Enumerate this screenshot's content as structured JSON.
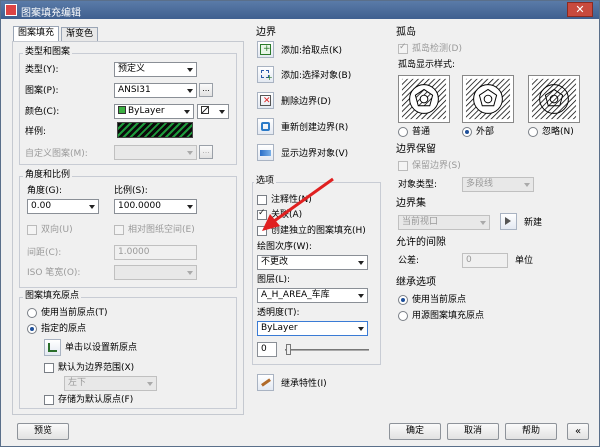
{
  "window": {
    "title": "图案填充编辑",
    "close_glyph": "✕"
  },
  "tabs": [
    {
      "label": "图案填充"
    },
    {
      "label": "渐变色"
    }
  ],
  "type_pattern": {
    "group_title": "类型和图案",
    "type_label": "类型(Y):",
    "type_value": "预定义",
    "pattern_label": "图案(P):",
    "pattern_value": "ANSI31",
    "color_label": "颜色(C):",
    "color_value": "ByLayer",
    "color_swatch": "#3cb043",
    "sample_label": "样例:",
    "custom_label": "自定义图案(M):",
    "browse_glyph": "..."
  },
  "angle_scale": {
    "group_title": "角度和比例",
    "angle_label": "角度(G):",
    "angle_value": "0.00",
    "scale_label": "比例(S):",
    "scale_value": "100.0000",
    "double_label": "双向(U)",
    "relative_label": "相对图纸空间(E)",
    "spacing_label": "间距(C):",
    "spacing_value": "1.0000",
    "iso_label": "ISO 笔宽(O):"
  },
  "origin": {
    "group_title": "图案填充原点",
    "current_label": "使用当前原点(T)",
    "specified_label": "指定的原点",
    "click_set_label": "单击以设置新原点",
    "default_extent_label": "默认为边界范围(X)",
    "extent_value": "左下",
    "store_label": "存储为默认原点(F)"
  },
  "boundary": {
    "group_title": "边界",
    "pick_points": "添加:拾取点(K)",
    "select_objects": "添加:选择对象(B)",
    "remove": "删除边界(D)",
    "recreate": "重新创建边界(R)",
    "display": "显示边界对象(V)"
  },
  "options": {
    "group_title": "选项",
    "annotative": "注释性(N)",
    "associative": "关联(A)",
    "separate": "创建独立的图案填充(H)",
    "draw_order_label": "绘图次序(W):",
    "draw_order_value": "不更改",
    "layer_label": "图层(L):",
    "layer_value": "A_H_AREA_车库",
    "transparency_label": "透明度(T):",
    "transparency_value": "ByLayer",
    "transparency_amount": "0"
  },
  "inherit": {
    "label": "继承特性(I)"
  },
  "islands": {
    "group_title": "孤岛",
    "detect_label": "孤岛检测(D)",
    "style_label": "孤岛显示样式:",
    "normal": "普通",
    "outer": "外部",
    "ignore": "忽略(N)"
  },
  "retention": {
    "group_title": "边界保留",
    "keep_label": "保留边界(S)",
    "object_type_label": "对象类型:",
    "object_type_value": "多段线"
  },
  "boundary_set": {
    "group_title": "边界集",
    "value": "当前视口",
    "new_label": "新建"
  },
  "gap": {
    "group_title": "允许的间隙",
    "tolerance_label": "公差:",
    "tolerance_value": "0",
    "unit_label": "单位"
  },
  "inherit_options": {
    "group_title": "继承选项",
    "current_origin": "使用当前原点",
    "source_origin": "用源图案填充原点"
  },
  "footer": {
    "preview": "预览",
    "ok": "确定",
    "cancel": "取消",
    "help": "帮助"
  }
}
